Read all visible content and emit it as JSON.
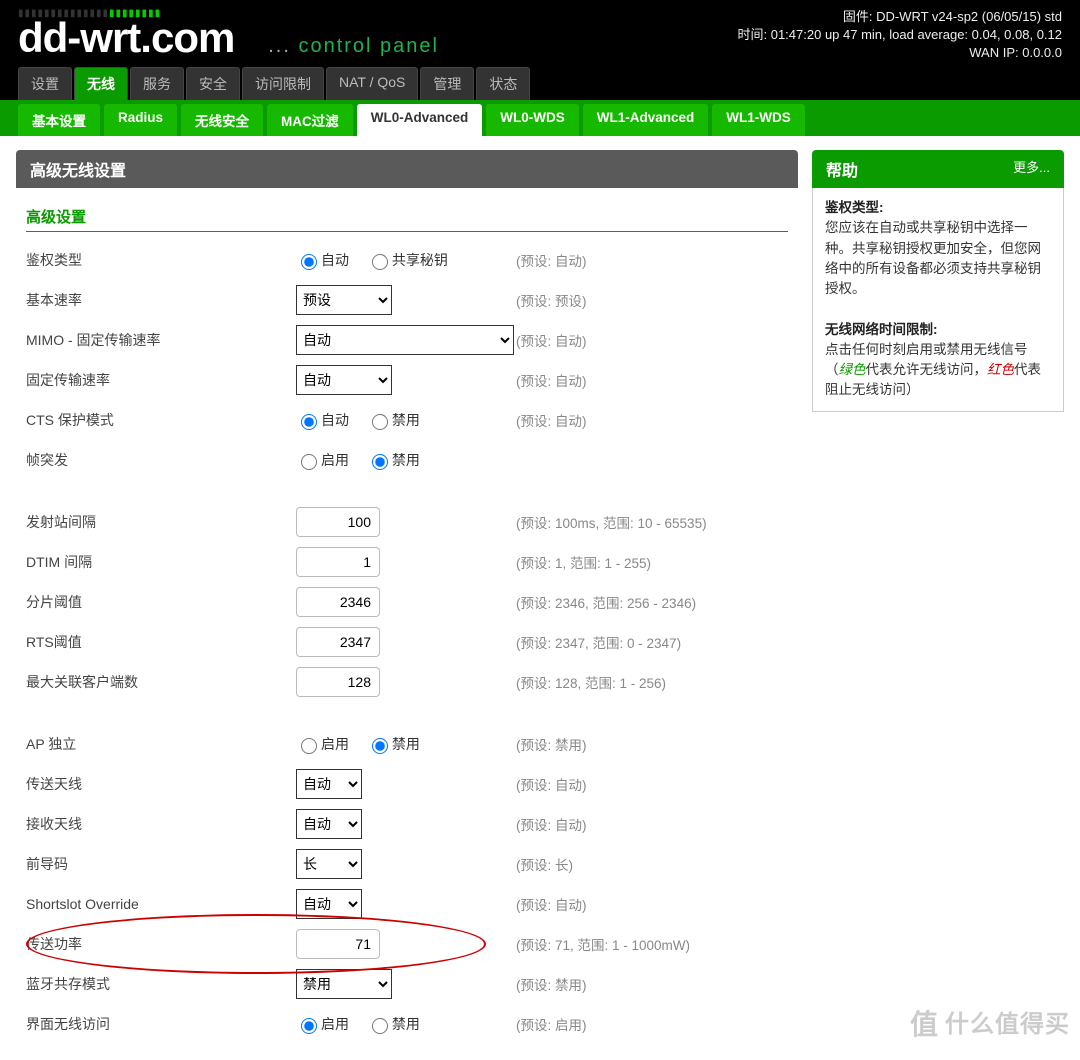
{
  "header": {
    "firmware": "固件: DD-WRT v24-sp2 (06/05/15) std",
    "time": "时间: 01:47:20 up 47 min, load average: 0.04, 0.08, 0.12",
    "wanip": "WAN IP: 0.0.0.0",
    "logo_dd": "dd-wrt",
    "logo_com": ".com",
    "cp_dots": "...",
    "cp": "control panel"
  },
  "tabs": {
    "main": [
      "设置",
      "无线",
      "服务",
      "安全",
      "访问限制",
      "NAT / QoS",
      "管理",
      "状态"
    ],
    "sub": [
      "基本设置",
      "Radius",
      "无线安全",
      "MAC过滤",
      "WL0-Advanced",
      "WL0-WDS",
      "WL1-Advanced",
      "WL1-WDS"
    ]
  },
  "panel": {
    "title": "高级无线设置",
    "legend": "高级设置"
  },
  "radio_opts": {
    "auto": "自动",
    "shared": "共享秘钥",
    "enable": "启用",
    "disable": "禁用"
  },
  "fields": {
    "auth": {
      "label": "鉴权类型",
      "def": "(预设: 自动)"
    },
    "basicrate": {
      "label": "基本速率",
      "value": "预设",
      "def": "(预设: 预设)"
    },
    "mimo": {
      "label": "MIMO - 固定传输速率",
      "value": "自动",
      "def": "(预设: 自动)"
    },
    "fixedrate": {
      "label": "固定传输速率",
      "value": "自动",
      "def": "(预设: 自动)"
    },
    "cts": {
      "label": "CTS 保护模式",
      "def": "(预设: 自动)"
    },
    "burst": {
      "label": "帧突发"
    },
    "beacon": {
      "label": "发射站间隔",
      "value": "100",
      "def": "(预设: 100ms, 范围: 10 - 65535)"
    },
    "dtim": {
      "label": "DTIM 间隔",
      "value": "1",
      "def": "(预设: 1, 范围: 1 - 255)"
    },
    "frag": {
      "label": "分片阈值",
      "value": "2346",
      "def": "(预设: 2346, 范围: 256 - 2346)"
    },
    "rts": {
      "label": "RTS阈值",
      "value": "2347",
      "def": "(预设: 2347, 范围: 0 - 2347)"
    },
    "maxclients": {
      "label": "最大关联客户端数",
      "value": "128",
      "def": "(预设: 128, 范围: 1 - 256)"
    },
    "apisolate": {
      "label": "AP 独立",
      "def": "(预设: 禁用)"
    },
    "txant": {
      "label": "传送天线",
      "value": "自动",
      "def": "(预设: 自动)"
    },
    "rxant": {
      "label": "接收天线",
      "value": "自动",
      "def": "(预设: 自动)"
    },
    "preamble": {
      "label": "前导码",
      "value": "长",
      "def": "(预设: 长)"
    },
    "shortslot": {
      "label": "Shortslot Override",
      "value": "自动",
      "def": "(预设: 自动)"
    },
    "txpower": {
      "label": "传送功率",
      "value": "71",
      "def": "(预设: 71, 范围: 1 - 1000mW)"
    },
    "btcoex": {
      "label": "蓝牙共存模式",
      "value": "禁用",
      "def": "(预设: 禁用)"
    },
    "guiaccess": {
      "label": "界面无线访问",
      "def": "(预设: 启用)"
    }
  },
  "help": {
    "title": "帮助",
    "more": "更多...",
    "auth_h": "鉴权类型:",
    "auth_b": "您应该在自动或共享秘钥中选择一种。共享秘钥授权更加安全，但您网络中的所有设备都必须支持共享秘钥授权。",
    "time_h": "无线网络时间限制:",
    "time_b1": "点击任何时刻启用或禁用无线信号（",
    "time_green": "绿色",
    "time_b2": "代表允许无线访问，",
    "time_red": "红色",
    "time_b3": "代表阻止无线访问）"
  },
  "watermark": {
    "zhi": "值",
    "txt": "什么值得买"
  }
}
